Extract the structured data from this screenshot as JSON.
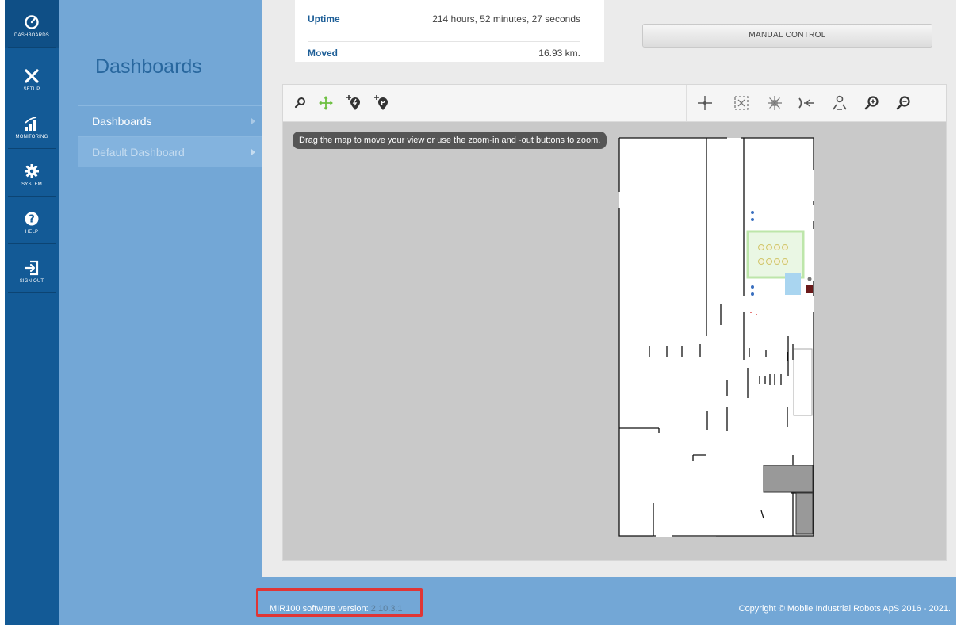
{
  "rail": {
    "items": [
      {
        "label": "DASHBOARDS",
        "icon": "speedometer-icon"
      },
      {
        "label": "SETUP",
        "icon": "tools-icon"
      },
      {
        "label": "MONITORING",
        "icon": "signal-bars-icon"
      },
      {
        "label": "SYSTEM",
        "icon": "gear-icon"
      },
      {
        "label": "HELP",
        "icon": "question-icon"
      },
      {
        "label": "SIGN OUT",
        "icon": "sign-out-icon"
      }
    ]
  },
  "subnav": {
    "title": "Dashboards",
    "items": [
      {
        "label": "Dashboards"
      },
      {
        "label": "Default Dashboard"
      }
    ]
  },
  "stats": {
    "uptime_label": "Uptime",
    "uptime_value": "214 hours, 52 minutes, 27 seconds",
    "moved_label": "Moved",
    "moved_value": "16.93 km."
  },
  "manual_control_label": "MANUAL CONTROL",
  "map": {
    "hint": "Drag the map to move your view or use the zoom-in and -out buttons to zoom.",
    "toolbar_left": [
      "search-icon",
      "move-icon",
      "add-charger-position-icon",
      "add-position-icon"
    ],
    "toolbar_right": [
      "crosshair-icon",
      "fit-map-icon",
      "sparkle-icon",
      "follow-robot-icon",
      "positions-icon",
      "zoom-in-icon",
      "zoom-out-icon"
    ],
    "active_tool": "move-icon"
  },
  "footer": {
    "version_label": "MIR100 software version:",
    "version_value": "2.10.3.1",
    "copyright": "Copyright © Mobile Industrial Robots ApS 2016 - 2021."
  },
  "colors": {
    "rail": "#135a96",
    "sidebar": "#73a7d6",
    "accent_active_tool": "#6cbf3f",
    "highlight_box": "#e03535"
  }
}
